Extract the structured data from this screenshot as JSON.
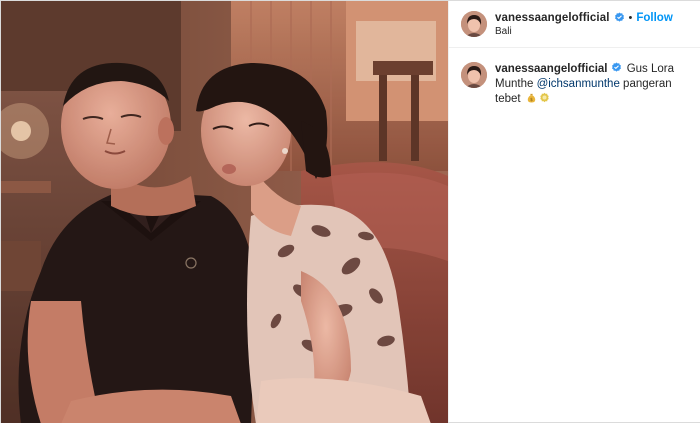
{
  "post": {
    "username": "vanessaangelofficial",
    "follow_label": "Follow",
    "separator": "•",
    "location": "Bali",
    "caption": {
      "username": "vanessaangelofficial",
      "text_before_mention": "Gus Lora Munthe",
      "mention": "@ichsanmunthe",
      "text_after_mention": "pangeran tebet",
      "emojis": [
        "money-bag-emoji",
        "gear-badge-emoji"
      ]
    }
  },
  "icons": {
    "verified": "verified-badge-icon"
  },
  "colors": {
    "follow": "#0095f6",
    "verified": "#3897f0",
    "mention": "#00376b",
    "text": "#262626",
    "border": "#dbdbdb"
  }
}
